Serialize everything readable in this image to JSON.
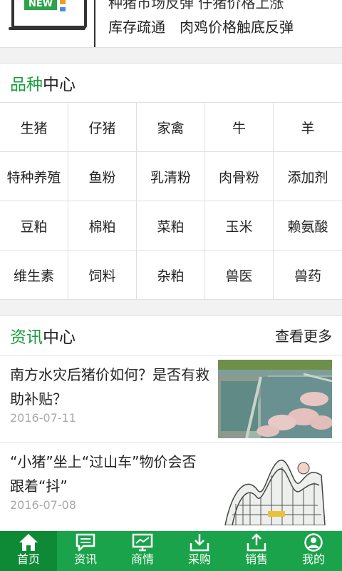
{
  "banner": {
    "tag": "NEW",
    "text_clipped": "种猪市场反弹 仔猪价格上涨",
    "text": "库存疏通　肉鸡价格触底反弹"
  },
  "category": {
    "title_highlight": "品种",
    "title_rest": "中心",
    "rows": [
      [
        "生猪",
        "仔猪",
        "家禽",
        "牛",
        "羊"
      ],
      [
        "特种养殖",
        "鱼粉",
        "乳清粉",
        "肉骨粉",
        "添加剂"
      ],
      [
        "豆粕",
        "棉粕",
        "菜粕",
        "玉米",
        "赖氨酸"
      ],
      [
        "维生素",
        "饲料",
        "杂粕",
        "兽医",
        "兽药"
      ]
    ]
  },
  "news": {
    "title_highlight": "资讯",
    "title_rest": "中心",
    "more_label": "查看更多",
    "items": [
      {
        "title": "南方水灾后猪价如何？是否有救助补贴？",
        "date": "2016-07-11"
      },
      {
        "title": "“小猪”坐上“过山车”物价会否跟着“抖”",
        "date": "2016-07-08"
      }
    ]
  },
  "nav": {
    "active_color": "#0e8a36",
    "bar_color": "#1aa34a",
    "items": [
      {
        "label": "首页",
        "icon": "home-icon"
      },
      {
        "label": "资讯",
        "icon": "message-icon"
      },
      {
        "label": "商情",
        "icon": "monitor-icon"
      },
      {
        "label": "采购",
        "icon": "download-icon"
      },
      {
        "label": "销售",
        "icon": "upload-icon"
      },
      {
        "label": "我的",
        "icon": "user-icon"
      }
    ]
  }
}
